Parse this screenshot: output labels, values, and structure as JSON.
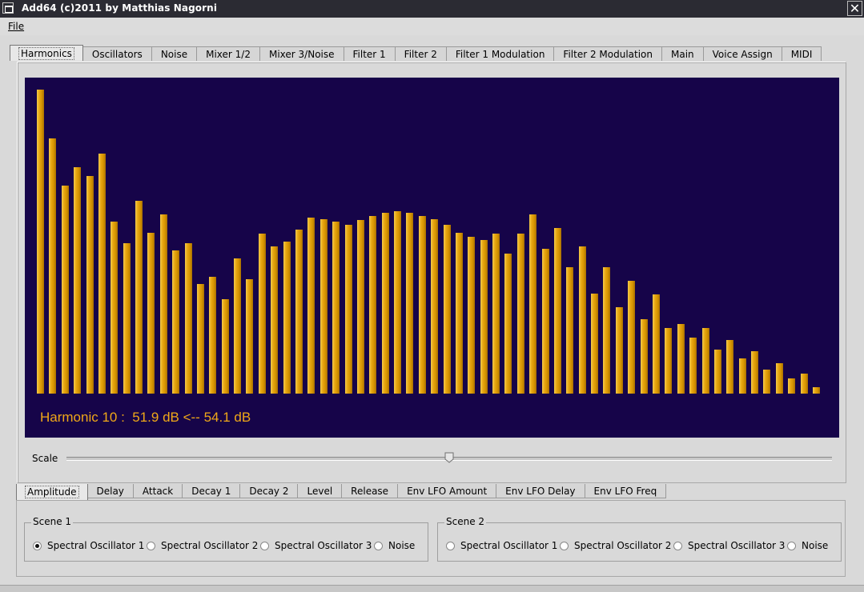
{
  "window": {
    "title": "Add64   (c)2011 by Matthias Nagorni",
    "close_label": "✕"
  },
  "menu": {
    "file_label": "File"
  },
  "main_tabs": [
    "Harmonics",
    "Oscillators",
    "Noise",
    "Mixer 1/2",
    "Mixer 3/Noise",
    "Filter 1",
    "Filter 2",
    "Filter 1 Modulation",
    "Filter 2 Modulation",
    "Main",
    "Voice Assign",
    "MIDI"
  ],
  "main_tab_active": 0,
  "spectrum": {
    "readout": "Harmonic 10 :  51.9 dB <-- 54.1 dB",
    "background_color": "#160449",
    "bar_color": "#e8a712",
    "harmonic_levels": [
      1.0,
      0.84,
      0.685,
      0.745,
      0.715,
      0.79,
      0.565,
      0.495,
      0.635,
      0.53,
      0.59,
      0.47,
      0.495,
      0.36,
      0.385,
      0.31,
      0.445,
      0.375,
      0.525,
      0.485,
      0.5,
      0.54,
      0.58,
      0.575,
      0.565,
      0.555,
      0.57,
      0.585,
      0.595,
      0.6,
      0.595,
      0.585,
      0.575,
      0.555,
      0.53,
      0.515,
      0.505,
      0.525,
      0.46,
      0.525,
      0.59,
      0.475,
      0.545,
      0.415,
      0.485,
      0.33,
      0.415,
      0.285,
      0.37,
      0.245,
      0.325,
      0.215,
      0.23,
      0.185,
      0.215,
      0.145,
      0.175,
      0.115,
      0.14,
      0.08,
      0.1,
      0.05,
      0.065,
      0.022
    ]
  },
  "scale": {
    "label": "Scale",
    "value": 0.5
  },
  "sub_tabs": [
    "Amplitude",
    "Delay",
    "Attack",
    "Decay 1",
    "Decay 2",
    "Level",
    "Release",
    "Env LFO Amount",
    "Env LFO Delay",
    "Env LFO Freq"
  ],
  "sub_tab_active": 0,
  "scene1": {
    "label": "Scene 1",
    "options": [
      "Spectral Oscillator 1",
      "Spectral Oscillator 2",
      "Spectral Oscillator 3",
      "Noise"
    ],
    "selected": 0
  },
  "scene2": {
    "label": "Scene 2",
    "options": [
      "Spectral Oscillator 1",
      "Spectral Oscillator 2",
      "Spectral Oscillator 3",
      "Noise"
    ],
    "selected": -1
  }
}
